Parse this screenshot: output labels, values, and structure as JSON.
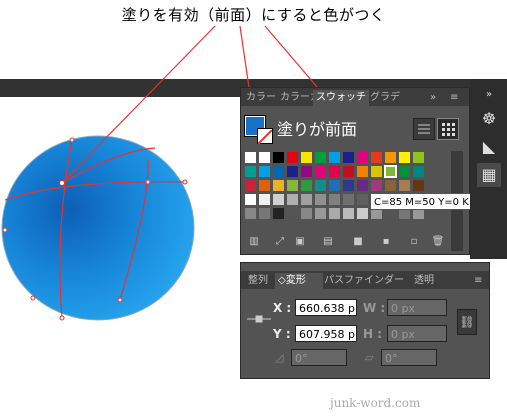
{
  "title": "塗りを有効（前面）にすると色がつく",
  "swatches_panel": {
    "tabs": [
      "カラー",
      "カラーガ",
      "スウォッチ",
      "グラデ"
    ],
    "fill_label": "塗りが前面",
    "tooltip": "C=85 M=50 Y=0 K=0",
    "menu_icon": "»"
  },
  "transform_panel": {
    "tabs": [
      "整列",
      "◇変形",
      "パスファインダー",
      "透明"
    ],
    "x_label": "X :",
    "x_value": "660.638 p",
    "y_label": "Y :",
    "y_value": "607.958 p",
    "w_label": "W :",
    "w_value": "0 px",
    "h_label": "H :",
    "h_value": "0 px",
    "rotate_value": "0°",
    "shear_value": "0°"
  },
  "watermark": "junk-word.com",
  "colors": {
    "panel_bg": "#535353",
    "dark": "#323232",
    "ball_main": "#1a8ee0",
    "red_line": "#e8322f"
  }
}
